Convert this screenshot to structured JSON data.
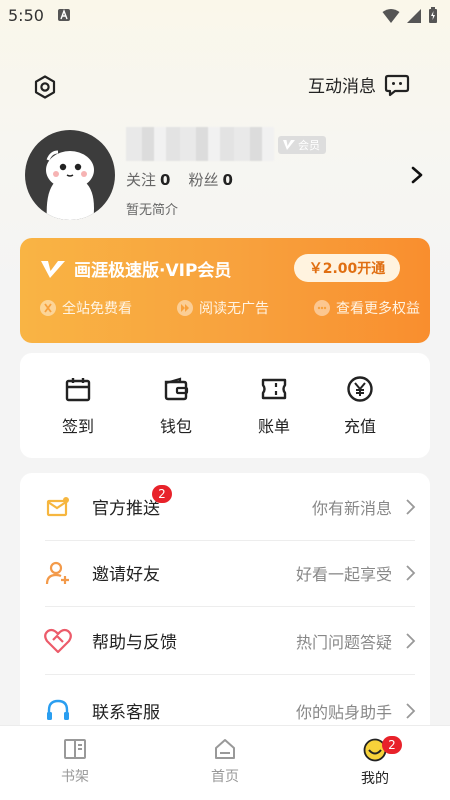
{
  "status_bar": {
    "time": "5:50"
  },
  "header": {
    "messages_label": "互动消息"
  },
  "profile": {
    "vip_badge": "会员",
    "follow_label": "关注",
    "follow_count": "0",
    "fans_label": "粉丝",
    "fans_count": "0",
    "bio": "暂无简介"
  },
  "vip_card": {
    "title": "画涯极速版·VIP会员",
    "cta": "￥2.00开通",
    "perks": [
      {
        "label": "全站免费看",
        "icon": "free-read-icon"
      },
      {
        "label": "阅读无广告",
        "icon": "no-ads-icon"
      },
      {
        "label": "查看更多权益",
        "icon": "more-icon"
      }
    ]
  },
  "shortcuts": [
    {
      "label": "签到",
      "icon": "calendar-icon"
    },
    {
      "label": "钱包",
      "icon": "wallet-icon"
    },
    {
      "label": "账单",
      "icon": "ticket-icon"
    },
    {
      "label": "充值",
      "icon": "yen-icon"
    }
  ],
  "menu": [
    {
      "label": "官方推送",
      "hint": "你有新消息",
      "badge": "2",
      "icon": "mail-icon"
    },
    {
      "label": "邀请好友",
      "hint": "好看一起享受",
      "icon": "add-user-icon"
    },
    {
      "label": "帮助与反馈",
      "hint": "热门问题答疑",
      "icon": "help-heart-icon"
    },
    {
      "label": "联系客服",
      "hint": "你的贴身助手",
      "icon": "headset-icon"
    }
  ],
  "tabbar": {
    "tabs": [
      {
        "label": "书架",
        "icon": "bookshelf-icon"
      },
      {
        "label": "首页",
        "icon": "home-icon"
      },
      {
        "label": "我的",
        "icon": "smiley-icon",
        "badge": "2",
        "active": true
      }
    ]
  },
  "colors": {
    "accent": "#f8a13d",
    "badge": "#e8222a"
  }
}
